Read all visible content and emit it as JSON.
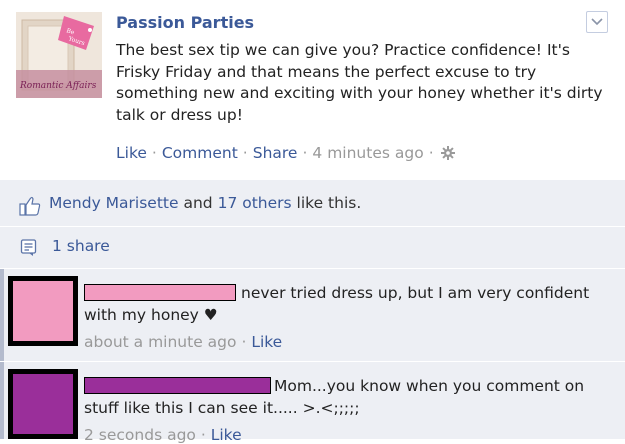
{
  "post": {
    "page_name": "Passion Parties",
    "body": "The best sex tip we can give you? Practice confidence! It's Frisky Friday and that means the perfect excuse to try something new and exciting with your honey whether it's dirty talk or dress up!",
    "actions": {
      "like": "Like",
      "comment": "Comment",
      "share": "Share",
      "time": "4 minutes ago",
      "dot": "·"
    },
    "thumbnail_text": "Romantic Affairs"
  },
  "likes": {
    "name": "Mendy Marisette",
    "and": "and",
    "others": "17 others",
    "suffix": "like this."
  },
  "shares": {
    "label": "1 share"
  },
  "comments": [
    {
      "text": "never tried dress up, but I am very confident with my honey ♥",
      "time": "about a minute ago",
      "like": "Like",
      "avatar_color": "#f29bc0",
      "redact_color": "#f29bc0"
    },
    {
      "text": "Mom...you know when you comment on stuff like this I can see it..... >.<;;;;;",
      "time": "2 seconds ago",
      "like": "Like",
      "avatar_color": "#9a2f9a",
      "redact_color": "#9a2f9a"
    }
  ],
  "colors": {
    "link": "#3b5998",
    "panel": "#edeff4",
    "meta": "#999999"
  },
  "icons": {
    "like": "thumbs-up-icon",
    "share": "share-icon",
    "gear": "gear-icon",
    "menu": "chevron-down-icon"
  }
}
